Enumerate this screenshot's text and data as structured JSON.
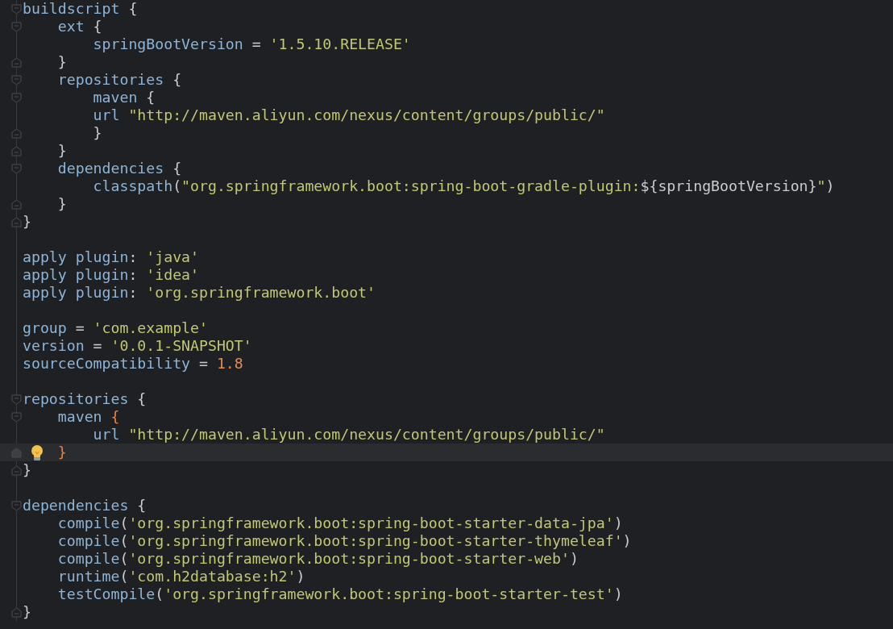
{
  "editor": {
    "blocks": [
      {
        "lines": [
          {
            "fold_open": true,
            "tokens": [
              {
                "kind": "ident",
                "text": "buildscript"
              },
              {
                "kind": "punct",
                "text": " {"
              }
            ]
          },
          {
            "fold_open": true,
            "tokens": [
              {
                "kind": "ident",
                "text": "    ext"
              },
              {
                "kind": "punct",
                "text": " {"
              }
            ]
          },
          {
            "tokens": [
              {
                "kind": "ident",
                "text": "        springBootVersion"
              },
              {
                "kind": "punct",
                "text": " = "
              },
              {
                "kind": "str",
                "text": "'1.5.10.RELEASE'"
              }
            ]
          },
          {
            "fold_close": true,
            "tokens": [
              {
                "kind": "punct",
                "text": "    }"
              }
            ]
          },
          {
            "fold_open": true,
            "tokens": [
              {
                "kind": "ident",
                "text": "    repositories"
              },
              {
                "kind": "punct",
                "text": " {"
              }
            ]
          },
          {
            "fold_open": true,
            "tokens": [
              {
                "kind": "ident",
                "text": "        maven"
              },
              {
                "kind": "punct",
                "text": " {"
              }
            ]
          },
          {
            "tokens": [
              {
                "kind": "ident",
                "text": "        url "
              },
              {
                "kind": "str",
                "text": "\"http://maven.aliyun.com/nexus/content/groups/public/\""
              }
            ]
          },
          {
            "fold_close": true,
            "tokens": [
              {
                "kind": "punct",
                "text": "        }"
              }
            ]
          },
          {
            "fold_close": true,
            "tokens": [
              {
                "kind": "punct",
                "text": "    }"
              }
            ]
          },
          {
            "fold_open": true,
            "tokens": [
              {
                "kind": "ident",
                "text": "    dependencies"
              },
              {
                "kind": "punct",
                "text": " {"
              }
            ]
          },
          {
            "tokens": [
              {
                "kind": "ident",
                "text": "        classpath"
              },
              {
                "kind": "punct",
                "text": "("
              },
              {
                "kind": "str",
                "text": "\"org.springframework.boot:spring-boot-gradle-plugin:"
              },
              {
                "kind": "punct",
                "text": "${springBootVersion}"
              },
              {
                "kind": "str",
                "text": "\""
              },
              {
                "kind": "punct",
                "text": ")"
              }
            ]
          },
          {
            "fold_close": true,
            "tokens": [
              {
                "kind": "punct",
                "text": "    }"
              }
            ]
          },
          {
            "fold_close": true,
            "tokens": [
              {
                "kind": "punct",
                "text": "}"
              }
            ]
          }
        ]
      },
      {
        "lines": [
          {
            "tokens": [
              {
                "kind": "ident",
                "text": "apply plugin"
              },
              {
                "kind": "punct",
                "text": ": "
              },
              {
                "kind": "str",
                "text": "'java'"
              }
            ]
          },
          {
            "tokens": [
              {
                "kind": "ident",
                "text": "apply plugin"
              },
              {
                "kind": "punct",
                "text": ": "
              },
              {
                "kind": "str",
                "text": "'idea'"
              }
            ]
          },
          {
            "tokens": [
              {
                "kind": "ident",
                "text": "apply plugin"
              },
              {
                "kind": "punct",
                "text": ": "
              },
              {
                "kind": "str",
                "text": "'org.springframework.boot'"
              }
            ]
          }
        ]
      },
      {
        "lines": [
          {
            "tokens": [
              {
                "kind": "ident",
                "text": "group"
              },
              {
                "kind": "punct",
                "text": " = "
              },
              {
                "kind": "str",
                "text": "'com.example'"
              }
            ]
          },
          {
            "tokens": [
              {
                "kind": "ident",
                "text": "version"
              },
              {
                "kind": "punct",
                "text": " = "
              },
              {
                "kind": "str",
                "text": "'0.0.1-SNAPSHOT'"
              }
            ]
          },
          {
            "tokens": [
              {
                "kind": "ident",
                "text": "sourceCompatibility"
              },
              {
                "kind": "punct",
                "text": " = "
              },
              {
                "kind": "num",
                "text": "1.8"
              }
            ]
          }
        ]
      },
      {
        "lines": [
          {
            "fold_open": true,
            "tokens": [
              {
                "kind": "ident",
                "text": "repositories"
              },
              {
                "kind": "punct",
                "text": " {"
              }
            ]
          },
          {
            "fold_open": true,
            "tokens": [
              {
                "kind": "ident",
                "text": "    maven "
              },
              {
                "kind": "match",
                "text": "{"
              }
            ]
          },
          {
            "tokens": [
              {
                "kind": "ident",
                "text": "        url "
              },
              {
                "kind": "str",
                "text": "\"http://maven.aliyun.com/nexus/content/groups/public/\""
              }
            ]
          },
          {
            "fold_close": true,
            "current": true,
            "hint": true,
            "tokens": [
              {
                "kind": "match",
                "text": "    }"
              }
            ]
          },
          {
            "fold_close": true,
            "tokens": [
              {
                "kind": "punct",
                "text": "}"
              }
            ]
          }
        ]
      },
      {
        "lines": [
          {
            "fold_open": true,
            "tokens": [
              {
                "kind": "ident",
                "text": "dependencies"
              },
              {
                "kind": "punct",
                "text": " {"
              }
            ]
          },
          {
            "tokens": [
              {
                "kind": "ident",
                "text": "    compile"
              },
              {
                "kind": "punct",
                "text": "("
              },
              {
                "kind": "str",
                "text": "'org.springframework.boot:spring-boot-starter-data-jpa'"
              },
              {
                "kind": "punct",
                "text": ")"
              }
            ]
          },
          {
            "tokens": [
              {
                "kind": "ident",
                "text": "    compile"
              },
              {
                "kind": "punct",
                "text": "("
              },
              {
                "kind": "str",
                "text": "'org.springframework.boot:spring-boot-starter-thymeleaf'"
              },
              {
                "kind": "punct",
                "text": ")"
              }
            ]
          },
          {
            "tokens": [
              {
                "kind": "ident",
                "text": "    compile"
              },
              {
                "kind": "punct",
                "text": "("
              },
              {
                "kind": "str",
                "text": "'org.springframework.boot:spring-boot-starter-web'"
              },
              {
                "kind": "punct",
                "text": ")"
              }
            ]
          },
          {
            "tokens": [
              {
                "kind": "ident",
                "text": "    runtime"
              },
              {
                "kind": "punct",
                "text": "("
              },
              {
                "kind": "str",
                "text": "'com.h2database:h2'"
              },
              {
                "kind": "punct",
                "text": ")"
              }
            ]
          },
          {
            "tokens": [
              {
                "kind": "ident",
                "text": "    testCompile"
              },
              {
                "kind": "punct",
                "text": "("
              },
              {
                "kind": "str",
                "text": "'org.springframework.boot:spring-boot-starter-test'"
              },
              {
                "kind": "punct",
                "text": ")"
              }
            ]
          },
          {
            "fold_close": true,
            "tokens": [
              {
                "kind": "punct",
                "text": "}"
              }
            ]
          }
        ]
      }
    ]
  }
}
